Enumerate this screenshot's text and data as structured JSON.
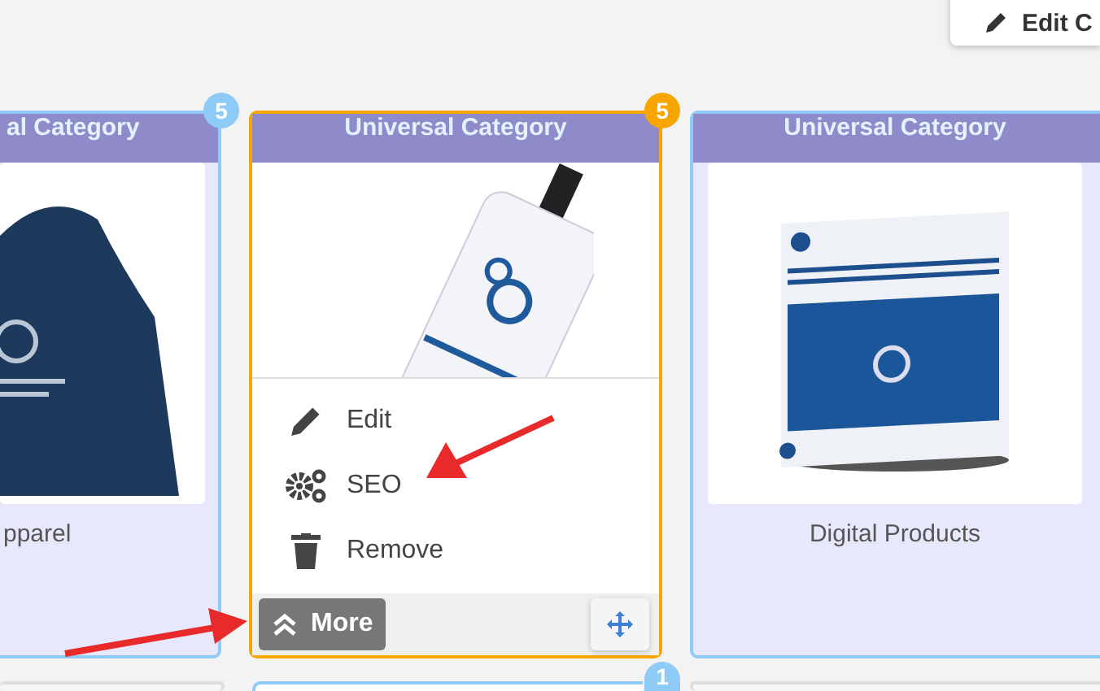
{
  "edit_button": {
    "label": "Edit C"
  },
  "cards": [
    {
      "category": "al Category",
      "badge": "5",
      "name": "pparel",
      "selected": false
    },
    {
      "category": "Universal Category",
      "badge": "5",
      "selected": true,
      "menu": [
        {
          "kind": "edit",
          "label": "Edit"
        },
        {
          "kind": "seo",
          "label": "SEO"
        },
        {
          "kind": "remove",
          "label": "Remove"
        }
      ],
      "more_label": "More"
    },
    {
      "category": "Universal Category",
      "name": "Digital Products",
      "selected": false
    }
  ],
  "next_row": [
    {
      "selected": false
    },
    {
      "selected": false,
      "badge": "1"
    },
    {
      "selected": false
    }
  ]
}
